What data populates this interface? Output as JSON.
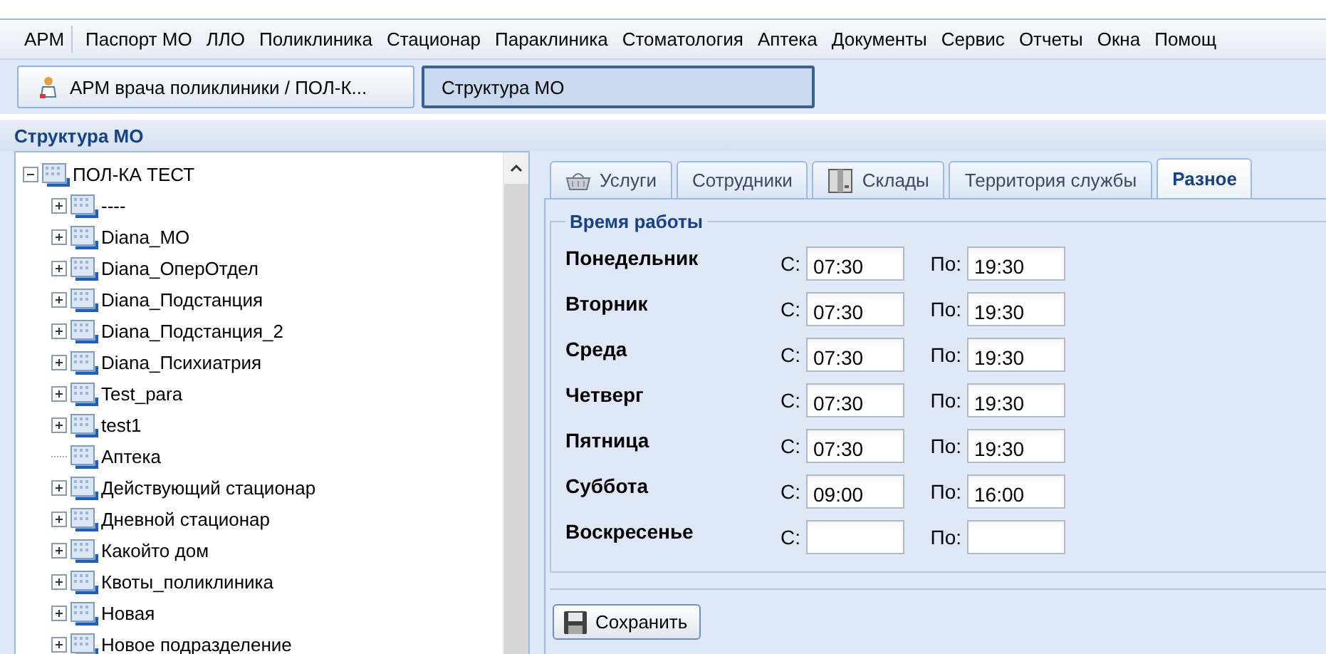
{
  "menu": [
    {
      "label": "АРМ"
    },
    {
      "label": "Паспорт МО"
    },
    {
      "label": "ЛЛО"
    },
    {
      "label": "Поликлиника"
    },
    {
      "label": "Стационар"
    },
    {
      "label": "Параклиника"
    },
    {
      "label": "Стоматология"
    },
    {
      "label": "Аптека"
    },
    {
      "label": "Документы"
    },
    {
      "label": "Сервис"
    },
    {
      "label": "Отчеты"
    },
    {
      "label": "Окна"
    },
    {
      "label": "Помощ"
    }
  ],
  "windows": [
    {
      "label": "АРМ врача поликлиники / ПОЛ-К...",
      "kind": "doctor",
      "selected": false
    },
    {
      "label": "Структура МО",
      "kind": "plain",
      "selected": true
    }
  ],
  "panel_title": "Структура МО",
  "tree": {
    "label": "ПОЛ-КА ТЕСТ",
    "expanded": true,
    "children": [
      {
        "label": "----",
        "expandable": true
      },
      {
        "label": "Diana_МО",
        "expandable": true
      },
      {
        "label": "Diana_ОперОтдел",
        "expandable": true
      },
      {
        "label": "Diana_Подстанция",
        "expandable": true
      },
      {
        "label": "Diana_Подстанция_2",
        "expandable": true
      },
      {
        "label": "Diana_Психиатрия",
        "expandable": true
      },
      {
        "label": "Test_para",
        "expandable": true
      },
      {
        "label": "test1",
        "expandable": true
      },
      {
        "label": "Аптека",
        "expandable": false
      },
      {
        "label": "Действующий стационар",
        "expandable": true
      },
      {
        "label": "Дневной стационар",
        "expandable": true
      },
      {
        "label": "Какойто дом",
        "expandable": true
      },
      {
        "label": "Квоты_поликлиника",
        "expandable": true
      },
      {
        "label": "Новая",
        "expandable": true
      },
      {
        "label": "Новое подразделение",
        "expandable": true
      }
    ]
  },
  "tabs": [
    {
      "label": "Услуги",
      "kind": "basket",
      "selected": false
    },
    {
      "label": "Сотрудники",
      "kind": "plain",
      "selected": false
    },
    {
      "label": "Склады",
      "kind": "box",
      "selected": false
    },
    {
      "label": "Территория службы",
      "kind": "plain",
      "selected": false
    },
    {
      "label": "Разное",
      "kind": "plain",
      "selected": true
    }
  ],
  "section_title": "Время работы",
  "schedule": [
    {
      "day": "Понедельник",
      "from_label": "С:",
      "from": "07:30",
      "to_label": "По:",
      "to": "19:30"
    },
    {
      "day": "Вторник",
      "from_label": "С:",
      "from": "07:30",
      "to_label": "По:",
      "to": "19:30"
    },
    {
      "day": "Среда",
      "from_label": "С:",
      "from": "07:30",
      "to_label": "По:",
      "to": "19:30"
    },
    {
      "day": "Четверг",
      "from_label": "С:",
      "from": "07:30",
      "to_label": "По:",
      "to": "19:30"
    },
    {
      "day": "Пятница",
      "from_label": "С:",
      "from": "07:30",
      "to_label": "По:",
      "to": "19:30"
    },
    {
      "day": "Суббота",
      "from_label": "С:",
      "from": "09:00",
      "to_label": "По:",
      "to": "16:00"
    },
    {
      "day": "Воскресенье",
      "from_label": "С:",
      "to_label": "По:"
    }
  ],
  "save_button": "Сохранить"
}
